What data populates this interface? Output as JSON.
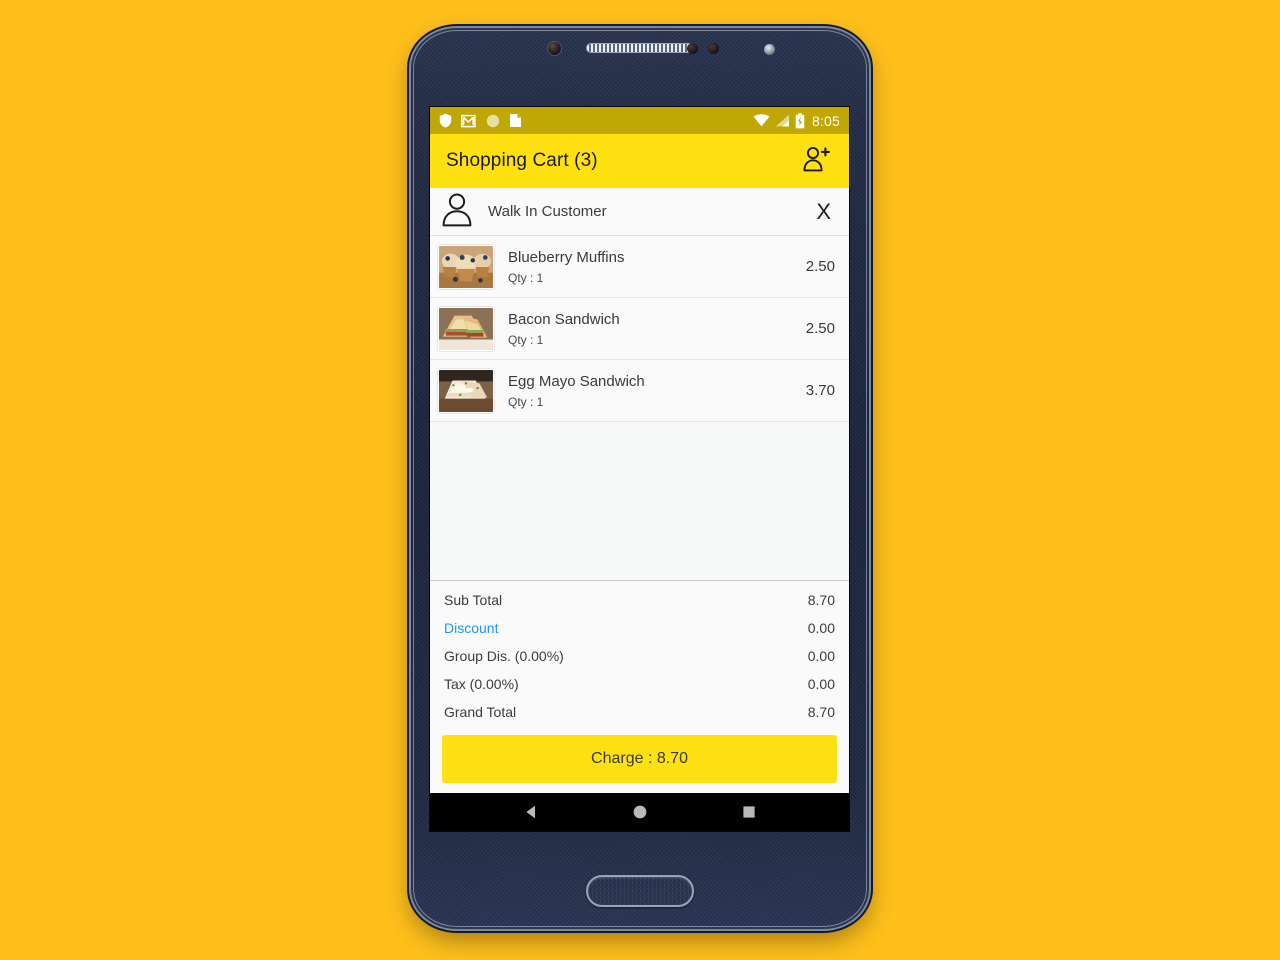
{
  "status_bar": {
    "time": "8:05",
    "left_icons": [
      "shield-icon",
      "gmail-icon",
      "circle-icon",
      "bag-icon"
    ],
    "right_icons": [
      "wifi-icon",
      "signal-icon",
      "battery-charging-icon"
    ],
    "background_color": "#BFA806"
  },
  "app_bar": {
    "title": "Shopping Cart (3)",
    "action_icon": "add-customer-icon",
    "background_color": "#FFE011",
    "text_color": "#1B1B1B"
  },
  "customer": {
    "icon": "person-icon",
    "name": "Walk In Customer",
    "remove_label": "X"
  },
  "cart": {
    "items": [
      {
        "name": "Blueberry Muffins",
        "qty_label": "Qty : 1",
        "price": "2.50",
        "thumb": "blueberry-muffins-photo"
      },
      {
        "name": "Bacon Sandwich",
        "qty_label": "Qty : 1",
        "price": "2.50",
        "thumb": "bacon-sandwich-photo"
      },
      {
        "name": "Egg Mayo Sandwich",
        "qty_label": "Qty : 1",
        "price": "3.70",
        "thumb": "egg-mayo-sandwich-photo"
      }
    ]
  },
  "totals": {
    "rows": [
      {
        "label": "Sub Total",
        "value": "8.70",
        "link": false
      },
      {
        "label": "Discount",
        "value": "0.00",
        "link": true
      },
      {
        "label": "Group Dis. (0.00%)",
        "value": "0.00",
        "link": false
      },
      {
        "label": "Tax (0.00%)",
        "value": "0.00",
        "link": false
      },
      {
        "label": "Grand Total",
        "value": "8.70",
        "link": false
      }
    ],
    "link_color": "#2196F3"
  },
  "charge_button": {
    "label": "Charge : 8.70",
    "background_color": "#FFE011"
  },
  "nav_bar": {
    "buttons": [
      "back-icon",
      "home-icon",
      "recents-icon"
    ],
    "background_color": "#000000"
  },
  "page": {
    "background_color": "#FFC01C",
    "device_body_color": "#1D2640"
  }
}
